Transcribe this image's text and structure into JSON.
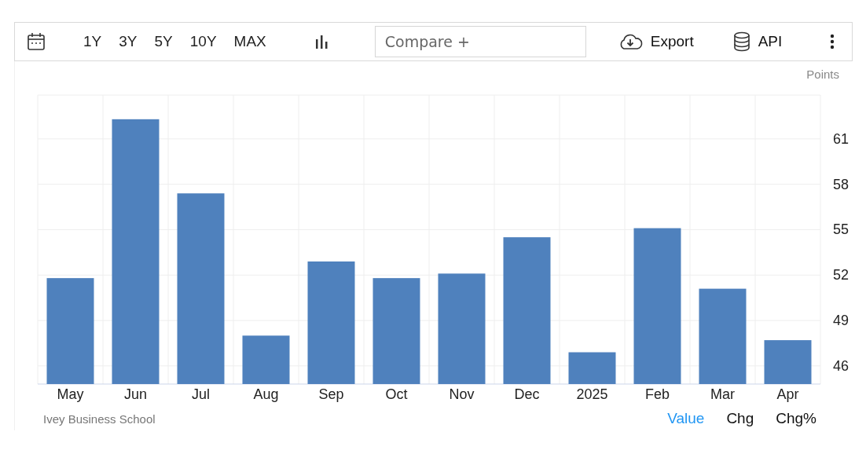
{
  "toolbar": {
    "ranges": [
      "1Y",
      "3Y",
      "5Y",
      "10Y",
      "MAX"
    ],
    "compare": {
      "placeholder": "Compare +"
    },
    "export": "Export",
    "api": "API"
  },
  "chart": {
    "chart_data": {
      "type": "bar",
      "ylabel": "Points",
      "categories": [
        "May",
        "Jun",
        "Jul",
        "Aug",
        "Sep",
        "Oct",
        "Nov",
        "Dec",
        "2025",
        "Feb",
        "Mar",
        "Apr"
      ],
      "series": [
        {
          "color": "#4f81bd",
          "values": [
            51.8,
            62.3,
            57.4,
            48.0,
            52.9,
            51.8,
            52.1,
            54.5,
            46.9,
            55.1,
            51.1,
            47.7
          ]
        }
      ],
      "ylim": [
        44.8,
        63.9
      ],
      "grid": true,
      "yticks": [
        46,
        49,
        52,
        55,
        58,
        61
      ]
    }
  },
  "footer": {
    "source": "Ivey Business School",
    "views": [
      {
        "label": "Value",
        "selected": true
      },
      {
        "label": "Chg",
        "selected": false
      },
      {
        "label": "Chg%",
        "selected": false
      }
    ]
  }
}
